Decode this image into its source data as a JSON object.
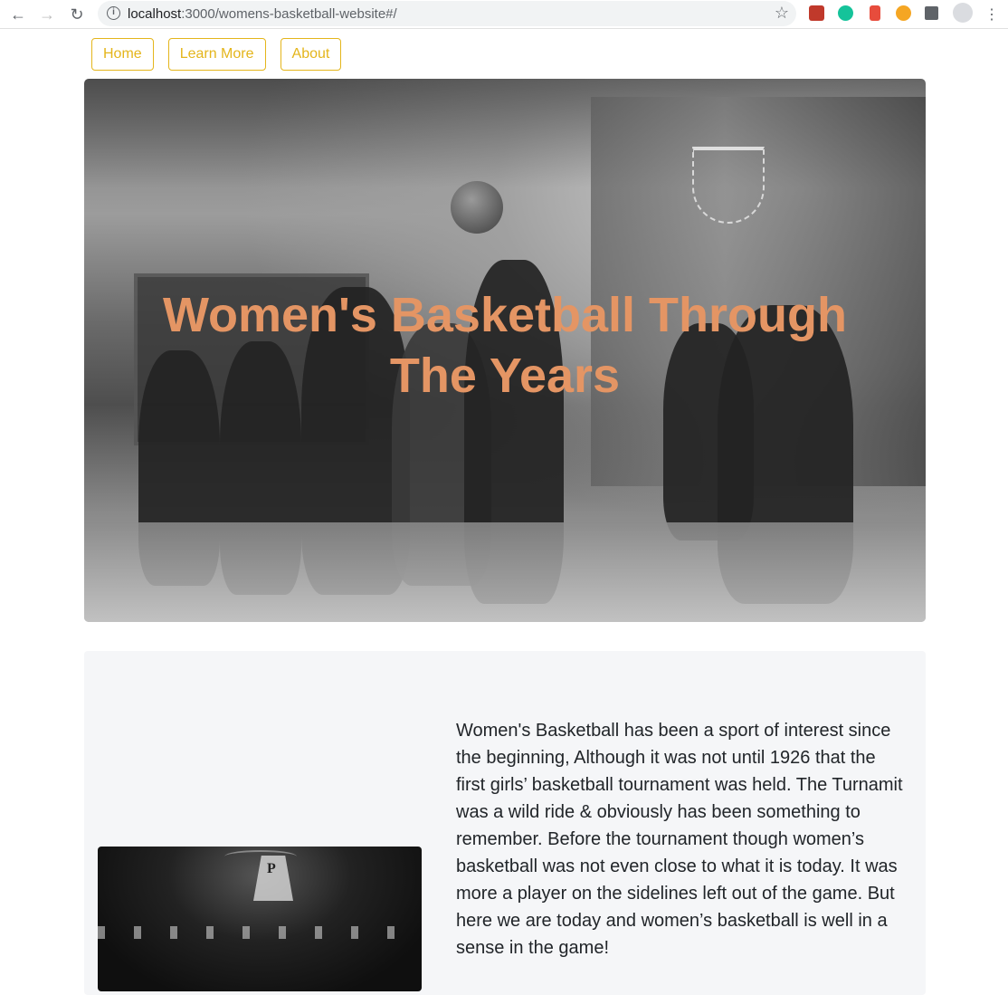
{
  "browser": {
    "url_host": "localhost",
    "url_path": ":3000/womens-basketball-website#/"
  },
  "nav": {
    "home": "Home",
    "learn_more": "Learn More",
    "about": "About"
  },
  "hero": {
    "title": "Women's Basketball Through The Years"
  },
  "content": {
    "paragraph1": "Women's Basketball has been a sport of interest since the beginning, Although it was not until 1926 that the first girls’ basketball tournament was held. The Turnamit was a wild ride & obviously has been something to remember. Before the tournament though women’s basketball was not even close to what it is today. It was more a player on the sidelines left out of the game. But here we are today and women’s basketball is well in a sense in the game!"
  },
  "colors": {
    "nav_accent": "#e4b51b",
    "hero_title": "#e49564",
    "content_bg": "#f5f6f8"
  }
}
